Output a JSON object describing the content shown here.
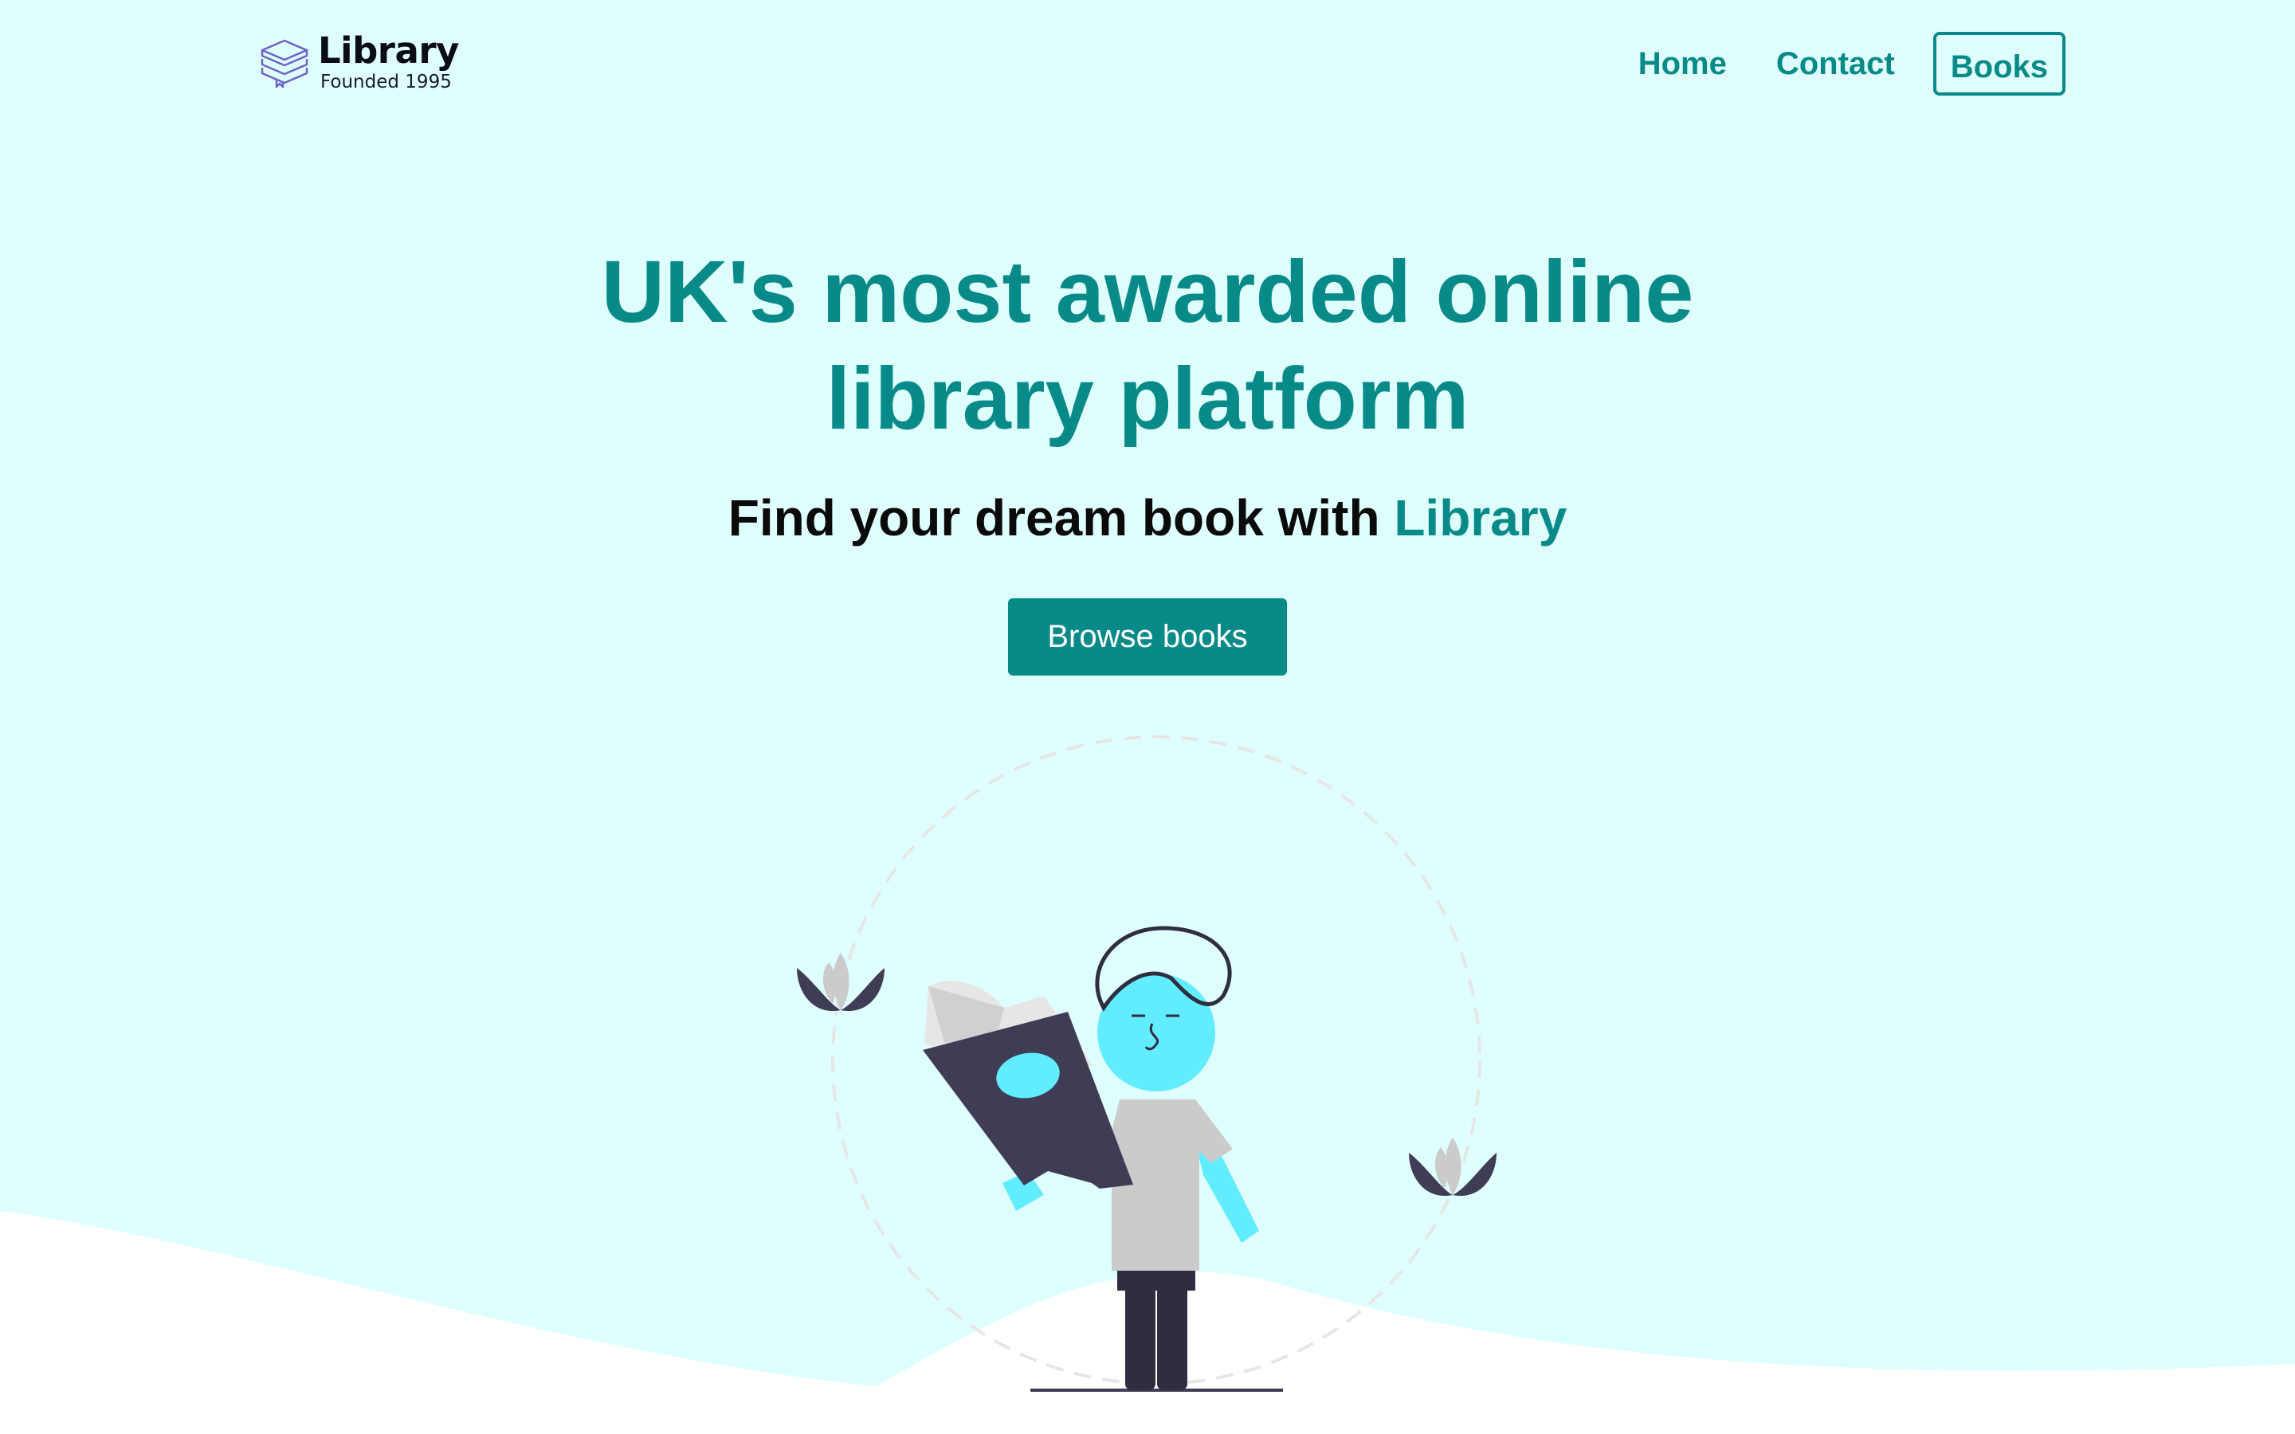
{
  "brand": {
    "name": "Library",
    "tagline": "Founded 1995",
    "icon": "stacked-books-icon"
  },
  "nav": {
    "home": "Home",
    "contact": "Contact",
    "books": "Books"
  },
  "hero": {
    "title_line1": "UK's most awarded online",
    "title_line2": "library platform",
    "subtitle_prefix": "Find your dream book with",
    "subtitle_accent": "Library",
    "cta_label": "Browse books"
  },
  "illustration": {
    "name": "person-reading-book-illustration"
  },
  "colors": {
    "accent": "#078a88",
    "background": "#dffffe",
    "skin": "#62ecff",
    "dark": "#3f3d56",
    "shirt": "#cbcbcb"
  }
}
